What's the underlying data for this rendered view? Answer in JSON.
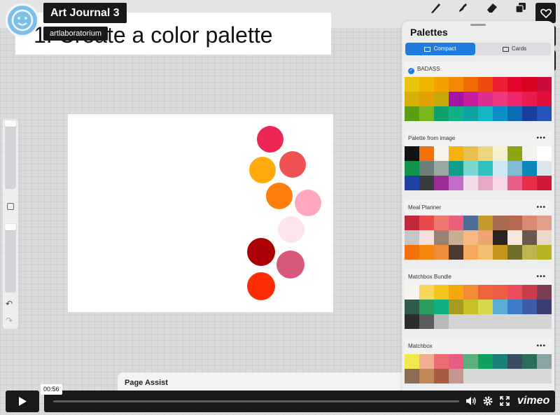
{
  "video": {
    "title": "Art Journal 3",
    "author": "artlaboratorium",
    "time": "00:56",
    "brand": "vimeo"
  },
  "canvas_text": {
    "heading": "1. Create a color palette"
  },
  "page_assist": {
    "label": "Page Assist"
  },
  "panel": {
    "title": "Palettes",
    "tabs": [
      {
        "label": "Compact",
        "active": true
      },
      {
        "label": "Cards",
        "active": false
      }
    ],
    "more_icon": "•••",
    "palettes": [
      {
        "name": "BADASS",
        "default": true,
        "colors": [
          "#e8c20c",
          "#f2b200",
          "#f4a100",
          "#f28900",
          "#ef6a00",
          "#ef4a10",
          "#ef1c36",
          "#e4052c",
          "#d80420",
          "#cc0a3c",
          "#d8b005",
          "#e4a002",
          "#c6a80b",
          "#a414a6",
          "#c61ca0",
          "#df2c91",
          "#ef3880",
          "#f0266c",
          "#ea1c4e",
          "#e0103a",
          "#5a9e12",
          "#7bb51d",
          "#0fa06c",
          "#10b088",
          "#0fa3a0",
          "#12b5c4",
          "#0c8ec9",
          "#0d6ab5",
          "#1a3e9c",
          "#2654ba"
        ]
      },
      {
        "name": "Palette from image",
        "default": false,
        "colors": [
          "#121212",
          "#f3710a",
          "#f9f3ea",
          "#f6b10c",
          "#e8c04e",
          "#ecd67c",
          "#f5f0d0",
          "#8ea510",
          "#f1f3ec",
          "#ffffff",
          "#12924c",
          "#6e7e78",
          "#9aa8a4",
          "#0f9d8c",
          "#7bd6d0",
          "#30c0c0",
          "#cde8f0",
          "#7fbcd2",
          "#0f86ba",
          "#dde6ea",
          "#2040a4",
          "#3a3c40",
          "#9a2c94",
          "#c06cc8",
          "#f2dcea",
          "#e8a8c8",
          "#f8d8e8",
          "#e8608a",
          "#ea2e4a",
          "#d01a38"
        ]
      },
      {
        "name": "Meal Planner",
        "default": false,
        "colors": [
          "#c0283c",
          "#e84a4a",
          "#f07870",
          "#e8607a",
          "#4c6e96",
          "#c49a2c",
          "#a86e54",
          "#b86852",
          "#d88a70",
          "#e2a08c",
          "#c4c6c8",
          "#f4dede",
          "#9a8070",
          "#c8ad8e",
          "#f7b884",
          "#f0a474",
          "#2a2420",
          "#f4e8dc",
          "#6a5a4e",
          "#ead8c8",
          "#f4700a",
          "#f4860c",
          "#ee8c3c",
          "#4a3a30",
          "#f4a860",
          "#f0c070",
          "#c4961c",
          "#6e6e2c",
          "#c0b450",
          "#b6b420"
        ]
      },
      {
        "name": "Matchbox Bundle",
        "default": false,
        "colors": [
          "#f7f4ee",
          "#f8d858",
          "#f7c61c",
          "#f4a80c",
          "#f28a38",
          "#f0643c",
          "#ee5c44",
          "#ec4c5c",
          "#c83c4c",
          "#7e3c54",
          "#2e5c4a",
          "#2e9c5c",
          "#10b084",
          "#a89a1c",
          "#c8c028",
          "#d8d84c",
          "#5cacd8",
          "#3c7cc8",
          "#3c5ca8",
          "#3c3c70",
          "#2c2c2c",
          "#5c5c5c",
          "#b8b8b8",
          "#d4d4d4",
          "#d4d4d4",
          "#d4d4d4",
          "#d4d4d4",
          "#d4d4d4",
          "#d4d4d4",
          "#d4d4d4"
        ]
      },
      {
        "name": "Matchbox",
        "default": false,
        "colors": [
          "#f0e84c",
          "#f0b090",
          "#ec6c74",
          "#e85c84",
          "#5cb07c",
          "#10a060",
          "#1c8078",
          "#3c4c60",
          "#2c6c5c",
          "#8aa4a4",
          "#8c6c54",
          "#c08858",
          "#a85c40",
          "#c49890",
          "#d8d8d8",
          "#d8d8d8",
          "#d8d8d8",
          "#d8d8d8",
          "#d8d8d8",
          "#d8d8d8"
        ]
      }
    ]
  },
  "canvas_dots": [
    {
      "color": "#ec2655"
    },
    {
      "color": "#ffab0b"
    },
    {
      "color": "#f25152"
    },
    {
      "color": "#fd7e0b"
    },
    {
      "color": "#fea7bf"
    },
    {
      "color": "#fde5ee"
    },
    {
      "color": "#ab0006"
    },
    {
      "color": "#d8587a"
    },
    {
      "color": "#fc2d05"
    }
  ],
  "icons": [
    "brush-icon",
    "smudge-icon",
    "eraser-icon",
    "layers-icon",
    "heart-icon",
    "clock-icon",
    "send-icon",
    "play-icon",
    "volume-icon",
    "settings-icon",
    "fullscreen-icon"
  ]
}
